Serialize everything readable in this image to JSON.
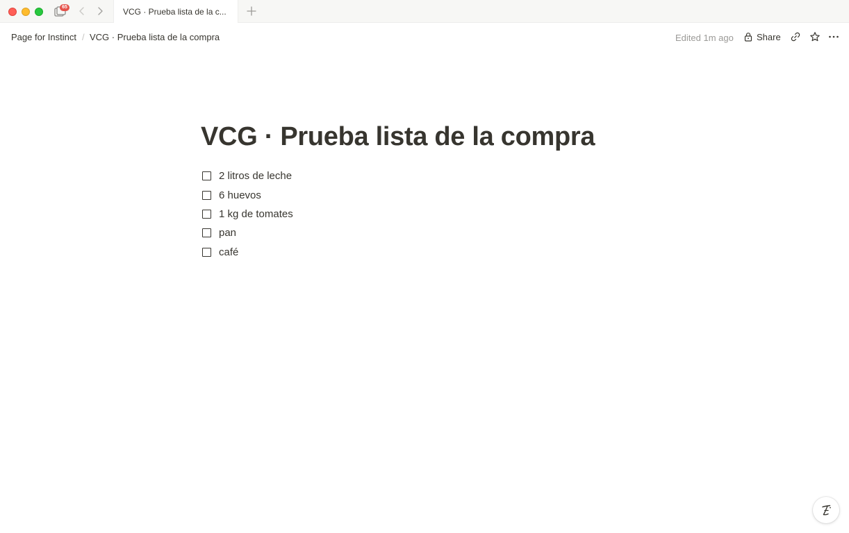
{
  "window": {
    "traffic_lights": [
      "close",
      "minimize",
      "zoom"
    ],
    "tabs_badge": "65",
    "tabs": [
      {
        "title": "VCG · Prueba lista de la c..."
      }
    ],
    "icons": {
      "tabs": "tabs-overview-icon",
      "back": "chevron-left-icon",
      "forward": "chevron-right-icon",
      "new_tab": "plus-icon"
    }
  },
  "topbar": {
    "breadcrumb": [
      "Page for Instinct",
      "VCG · Prueba lista de la compra"
    ],
    "breadcrumb_separator": "/",
    "edited": "Edited 1m ago",
    "share_label": "Share",
    "icons": {
      "share": "lock-icon",
      "copy_link": "link-icon",
      "favorite": "star-icon",
      "more": "more-horizontal-icon"
    }
  },
  "page": {
    "title": "VCG · Prueba lista de la compra",
    "todos": [
      {
        "text": "2 litros de leche",
        "checked": false
      },
      {
        "text": "6 huevos",
        "checked": false
      },
      {
        "text": "1 kg de tomates",
        "checked": false
      },
      {
        "text": "pan",
        "checked": false
      },
      {
        "text": "café",
        "checked": false
      }
    ]
  },
  "help_button": {
    "icon": "ai-assistant-icon"
  },
  "colors": {
    "text": "#37352f",
    "muted": "#9b9a97",
    "tabbar_bg": "#f7f7f5",
    "badge": "#e5534b",
    "close": "#ff5f57",
    "minimize": "#febc2e",
    "zoom": "#28c840"
  }
}
